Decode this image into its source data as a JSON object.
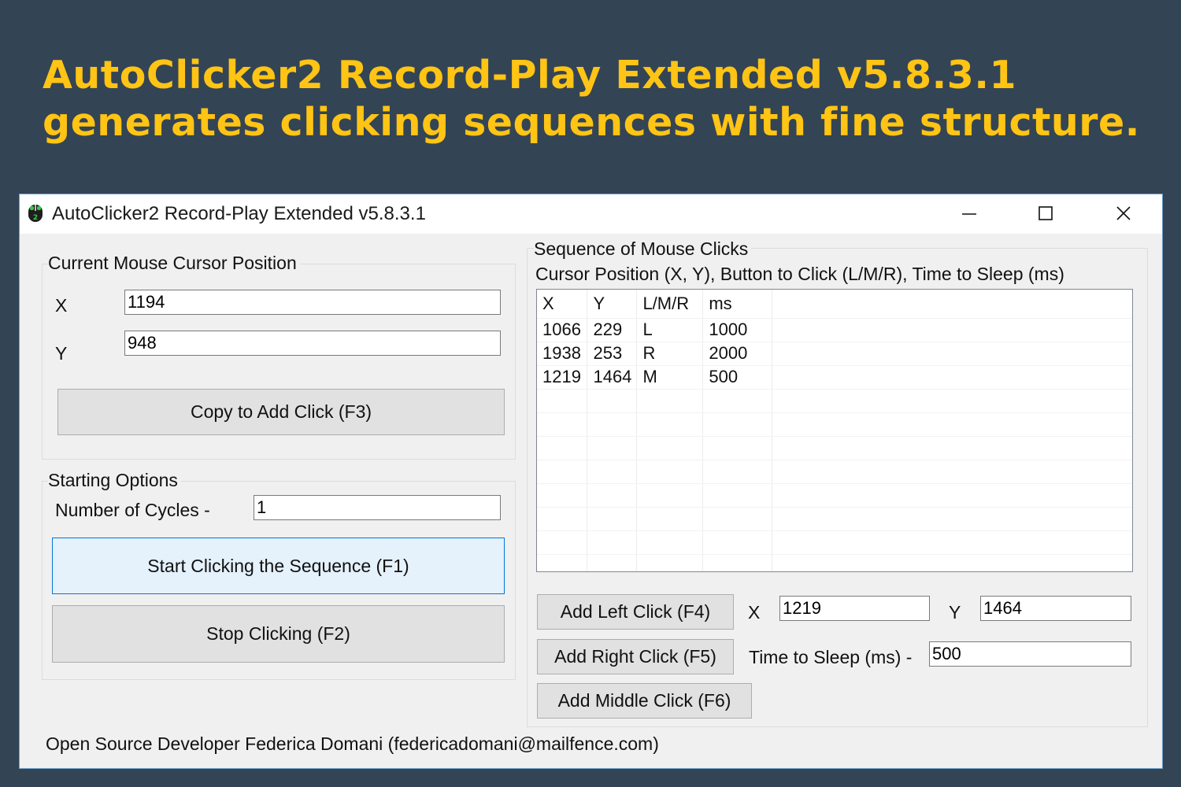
{
  "headline": {
    "line1": "AutoClicker2 Record-Play Extended v5.8.3.1",
    "line2": "generates clicking sequences with fine structure."
  },
  "window": {
    "title": "AutoClicker2 Record-Play Extended v5.8.3.1",
    "icon": "mouse-icon",
    "controls": [
      "minimize-icon",
      "maximize-icon",
      "close-icon"
    ]
  },
  "cursor_group": {
    "title": "Current Mouse Cursor Position",
    "x_label": "X",
    "x_value": "1194",
    "y_label": "Y",
    "y_value": "948",
    "copy_button": "Copy to Add Click (F3)"
  },
  "starting_options": {
    "title": "Starting Options",
    "cycles_label": "Number of Cycles -",
    "cycles_value": "1",
    "start_button": "Start Clicking the Sequence (F1)",
    "stop_button": "Stop Clicking (F2)"
  },
  "sequence": {
    "title": "Sequence of Mouse Clicks",
    "subtitle": "Cursor Position (X, Y), Button to Click (L/M/R), Time to Sleep (ms)",
    "columns": [
      "X",
      "Y",
      "L/M/R",
      "ms"
    ],
    "rows": [
      [
        "1066",
        "229",
        "L",
        "1000"
      ],
      [
        "1938",
        "253",
        "R",
        "2000"
      ],
      [
        "1219",
        "1464",
        "M",
        "500"
      ]
    ],
    "add_left_button": "Add Left Click (F4)",
    "add_right_button": "Add Right Click (F5)",
    "add_middle_button": "Add Middle Click (F6)",
    "x_label": "X",
    "x_value": "1219",
    "y_label": "Y",
    "y_value": "1464",
    "sleep_label": "Time to Sleep (ms) -",
    "sleep_value": "500"
  },
  "footer": "Open Source Developer Federica Domani (federicadomani@mailfence.com)",
  "colors": {
    "background": "#334455",
    "headline": "#ffc414",
    "window": "#f0f0f0",
    "primary_button_fill": "#e5f1fb",
    "primary_button_border": "#0078d7"
  }
}
